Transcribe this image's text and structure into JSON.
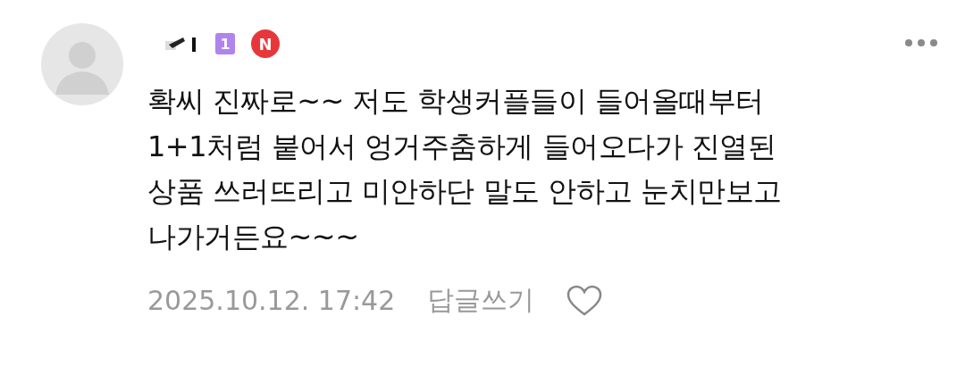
{
  "comment": {
    "author": {
      "level_badge": "1",
      "new_badge": "N"
    },
    "text": "확씨 진짜로~~ 저도 학생커플들이 들어올때부터\n1+1처럼 붙어서 엉거주춤하게 들어오다가 진열된\n상품 쓰러뜨리고 미안하단 말도 안하고 눈치만보고\n나가거든요~~~",
    "date": "2025.10.12. 17:42",
    "reply_label": "답글쓰기",
    "liked": false
  }
}
